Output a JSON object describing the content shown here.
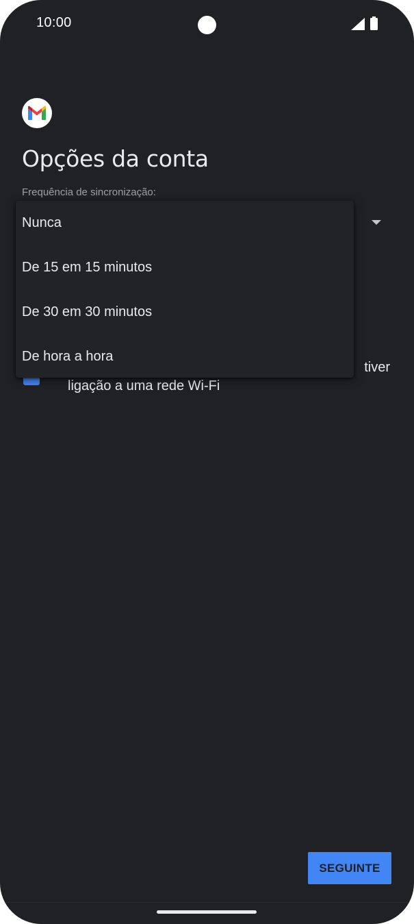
{
  "status_bar": {
    "time": "10:00"
  },
  "app": {
    "logo_icon": "gmail-logo-icon",
    "colors": {
      "background": "#202124",
      "accent": "#4285f4",
      "menu_background": "#222326"
    }
  },
  "page": {
    "title": "Opções da conta",
    "sync_label": "Frequência de sincronização:"
  },
  "dropdown": {
    "selected": "Nunca",
    "options": [
      {
        "label": "Nunca"
      },
      {
        "label": "De 15 em 15 minutos"
      },
      {
        "label": "De 30 em 30 minutos"
      },
      {
        "label": "De hora a hora"
      }
    ]
  },
  "wifi_option": {
    "line1": "tiver",
    "line2": "ligação a uma rede Wi-Fi",
    "checked": true
  },
  "footer": {
    "next_label": "SEGUINTE"
  }
}
